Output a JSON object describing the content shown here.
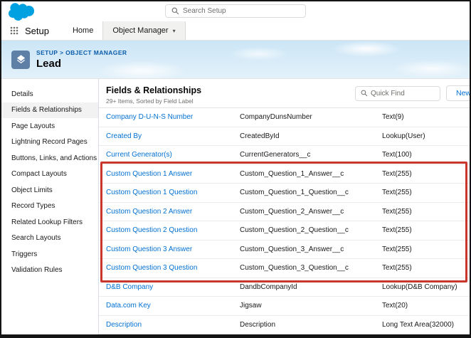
{
  "colors": {
    "salesforce_blue": "#00A1E0",
    "link_blue": "#0070D2",
    "annotation_red": "#C9362C"
  },
  "topbar": {
    "search_placeholder": "Search Setup"
  },
  "nav": {
    "app_label": "Setup",
    "tabs": [
      {
        "label": "Home"
      },
      {
        "label": "Object Manager"
      }
    ]
  },
  "icons": {
    "chevron_down": "▾"
  },
  "page_header": {
    "breadcrumb": "SETUP > OBJECT MANAGER",
    "title": "Lead"
  },
  "sidebar": {
    "items": [
      {
        "label": "Details"
      },
      {
        "label": "Fields & Relationships"
      },
      {
        "label": "Page Layouts"
      },
      {
        "label": "Lightning Record Pages"
      },
      {
        "label": "Buttons, Links, and Actions"
      },
      {
        "label": "Compact Layouts"
      },
      {
        "label": "Object Limits"
      },
      {
        "label": "Record Types"
      },
      {
        "label": "Related Lookup Filters"
      },
      {
        "label": "Search Layouts"
      },
      {
        "label": "Triggers"
      },
      {
        "label": "Validation Rules"
      }
    ]
  },
  "main": {
    "title": "Fields & Relationships",
    "subtitle": "29+ Items, Sorted by Field Label",
    "quick_find_placeholder": "Quick Find",
    "new_button_label": "New",
    "table": {
      "rows": [
        {
          "label": "Company D-U-N-S Number",
          "api_name": "CompanyDunsNumber",
          "type": "Text(9)"
        },
        {
          "label": "Created By",
          "api_name": "CreatedById",
          "type": "Lookup(User)"
        },
        {
          "label": "Current Generator(s)",
          "api_name": "CurrentGenerators__c",
          "type": "Text(100)"
        },
        {
          "label": "Custom Question 1 Answer",
          "api_name": "Custom_Question_1_Answer__c",
          "type": "Text(255)"
        },
        {
          "label": "Custom Question 1 Question",
          "api_name": "Custom_Question_1_Question__c",
          "type": "Text(255)"
        },
        {
          "label": "Custom Question 2 Answer",
          "api_name": "Custom_Question_2_Answer__c",
          "type": "Text(255)"
        },
        {
          "label": "Custom Question 2 Question",
          "api_name": "Custom_Question_2_Question__c",
          "type": "Text(255)"
        },
        {
          "label": "Custom Question 3 Answer",
          "api_name": "Custom_Question_3_Answer__c",
          "type": "Text(255)"
        },
        {
          "label": "Custom Question 3 Question",
          "api_name": "Custom_Question_3_Question__c",
          "type": "Text(255)"
        },
        {
          "label": "D&B Company",
          "api_name": "DandbCompanyId",
          "type": "Lookup(D&B Company)"
        },
        {
          "label": "Data.com Key",
          "api_name": "Jigsaw",
          "type": "Text(20)"
        },
        {
          "label": "Description",
          "api_name": "Description",
          "type": "Long Text Area(32000)"
        }
      ]
    }
  },
  "annotation": {
    "border_css": "border:3px solid #C9362C"
  }
}
